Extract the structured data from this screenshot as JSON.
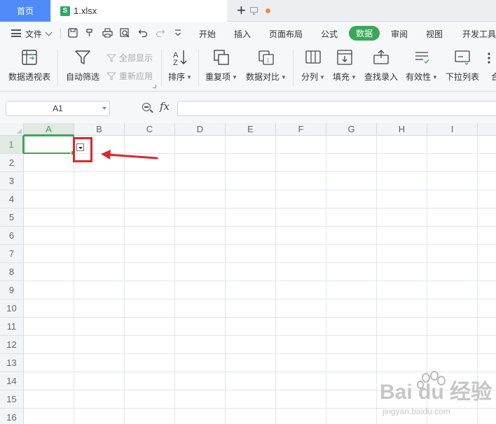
{
  "tabs": {
    "home": "首页",
    "file_icon": "S",
    "file_name": "1.xlsx",
    "add": "+"
  },
  "menu": {
    "file": "文件",
    "tabs": [
      "开始",
      "插入",
      "页面布局",
      "公式",
      "数据",
      "审阅",
      "视图",
      "开发工具"
    ],
    "active_tab": "数据"
  },
  "ribbon": {
    "pivot": "数据透视表",
    "autofilter": "自动筛选",
    "show_all": "全部显示",
    "reapply": "重新应用",
    "sort": "排序",
    "duplicates": "重复项",
    "compare": "数据对比",
    "split": "分列",
    "fill": "填充",
    "lookup": "查找录入",
    "validity": "有效性",
    "dropdown_list": "下拉列表",
    "merge": "合"
  },
  "formula": {
    "cell_ref": "A1",
    "fx": "fx",
    "value": ""
  },
  "grid": {
    "columns": [
      "A",
      "B",
      "C",
      "D",
      "E",
      "F",
      "G",
      "H",
      "I"
    ],
    "rows": [
      "1",
      "2",
      "3",
      "4",
      "5",
      "6",
      "7",
      "8",
      "9",
      "10",
      "11",
      "12",
      "13",
      "14",
      "15",
      "16"
    ],
    "selected_column": "A",
    "selected_row": "1"
  },
  "colors": {
    "accent_green": "#3aa856",
    "home_tab_blue": "#4f8cf7",
    "annotation_red": "#e0262c"
  },
  "watermark": {
    "brand": "Bai du 经验",
    "url": "jingyan.baidu.com"
  }
}
